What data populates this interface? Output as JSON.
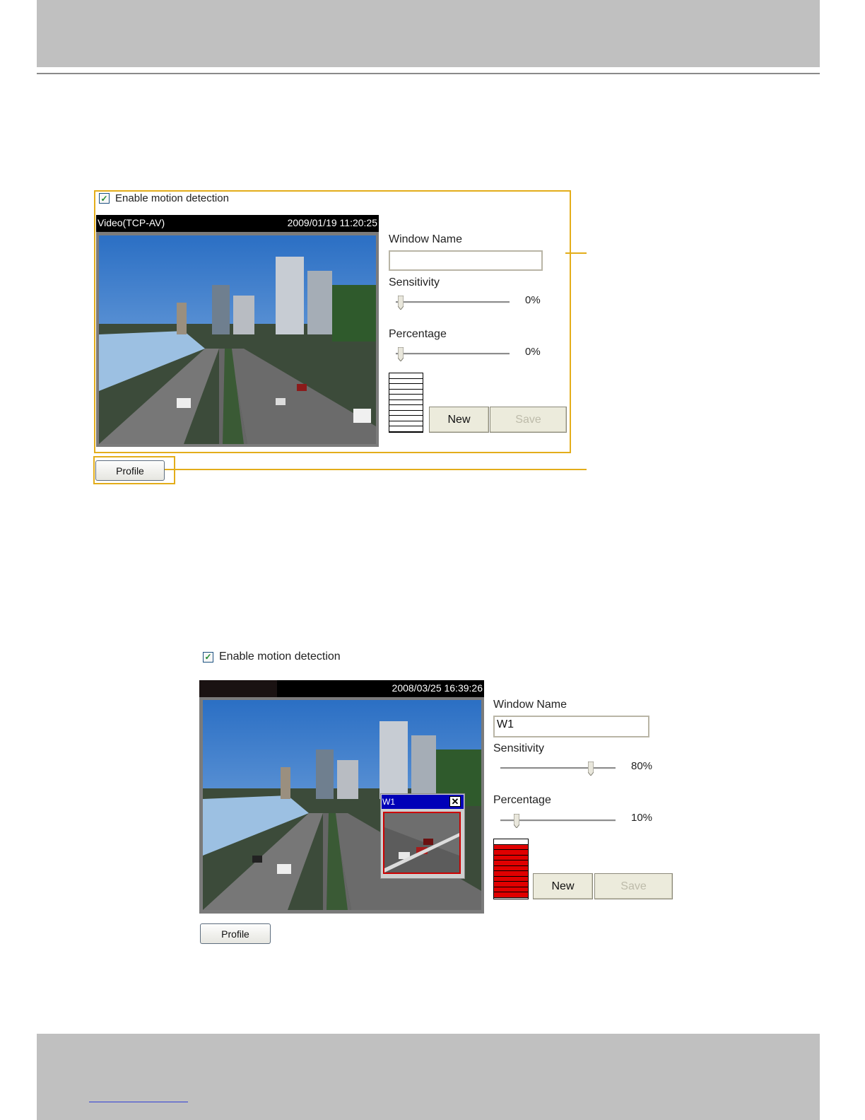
{
  "screenshot1": {
    "enable_label": "Enable motion detection",
    "video_label": "Video(TCP-AV)",
    "timestamp": "2009/01/19 11:20:25",
    "window_name_label": "Window Name",
    "window_name_value": "",
    "sensitivity_label": "Sensitivity",
    "sensitivity_value": "0%",
    "percentage_label": "Percentage",
    "percentage_value": "0%",
    "new_label": "New",
    "save_label": "Save",
    "profile_label": "Profile"
  },
  "screenshot2": {
    "enable_label": "Enable motion detection",
    "timestamp": "2008/03/25 16:39:26",
    "window_name_label": "Window Name",
    "window_name_value": "W1",
    "sensitivity_label": "Sensitivity",
    "sensitivity_value": "80%",
    "percentage_label": "Percentage",
    "percentage_value": "10%",
    "motion_window_title": "W1",
    "new_label": "New",
    "save_label": "Save",
    "profile_label": "Profile"
  },
  "icons": [
    "checkbox-checked-icon",
    "slider-thumb-icon",
    "close-icon"
  ]
}
